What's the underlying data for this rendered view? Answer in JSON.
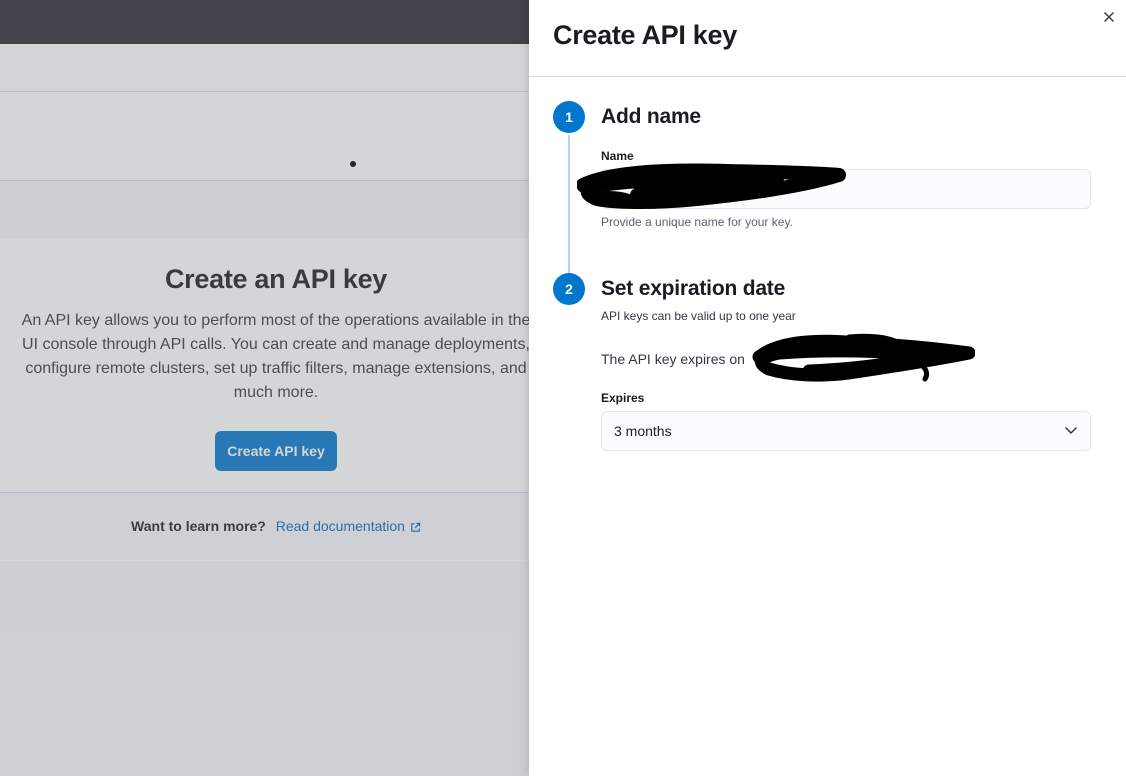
{
  "background": {
    "empty_state": {
      "title": "Create an API key",
      "description": "An API key allows you to perform most of the operations available in the UI console through API calls. You can create and manage deployments, configure remote clusters, set up traffic filters, manage extensions, and much more.",
      "button_label": "Create API key"
    },
    "footer": {
      "label": "Want to learn more?",
      "link": "Read documentation",
      "link_icon": "external-link-icon"
    }
  },
  "flyout": {
    "title": "Create API key",
    "close_icon": "close-icon",
    "steps": [
      {
        "number": "1",
        "title": "Add name",
        "field_label": "Name",
        "field_value": "",
        "help_text": "Provide a unique name for your key."
      },
      {
        "number": "2",
        "title": "Set expiration date",
        "subtitle": "API keys can be valid up to one year",
        "expires_text": "The API key expires on",
        "select_label": "Expires",
        "select_value": "3 months",
        "select_icon": "chevron-down-icon"
      }
    ]
  },
  "colors": {
    "primary": "#0077cc",
    "link": "#006bb8",
    "topbar": "#25282f"
  }
}
